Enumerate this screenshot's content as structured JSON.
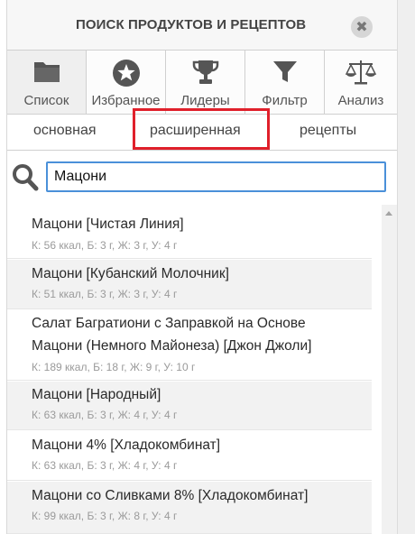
{
  "header": {
    "title": "ПОИСК ПРОДУКТОВ И РЕЦЕПТОВ",
    "close_symbol": "✖"
  },
  "toolbar": {
    "items": [
      {
        "label": "Список",
        "icon": "folder-icon",
        "active": true
      },
      {
        "label": "Избранное",
        "icon": "star-icon"
      },
      {
        "label": "Лидеры",
        "icon": "trophy-icon"
      },
      {
        "label": "Фильтр",
        "icon": "filter-icon"
      },
      {
        "label": "Анализ",
        "icon": "scales-icon"
      }
    ]
  },
  "subtabs": [
    "основная",
    "расширенная",
    "рецепты"
  ],
  "search": {
    "value": "Мацони",
    "icon": "search-icon"
  },
  "results": [
    {
      "name": "Мацони [Чистая Линия]",
      "nutrition": "К: 56 ккал, Б: 3 г, Ж: 3 г, У: 4 г"
    },
    {
      "name": "Мацони [Кубанский Молочник]",
      "nutrition": "К: 51 ккал, Б: 3 г, Ж: 3 г, У: 4 г"
    },
    {
      "name_line1": "Салат Багратиони с Заправкой на Основе",
      "name_line2": "Мацони (Немного Майонеза) [Джон Джоли]",
      "nutrition": "К: 189 ккал, Б: 18 г, Ж: 9 г, У: 10 г"
    },
    {
      "name": "Мацони [Народный]",
      "nutrition": "К: 63 ккал, Б: 3 г, Ж: 4 г, У: 4 г"
    },
    {
      "name": "Мацони 4% [Хладокомбинат]",
      "nutrition": "К: 63 ккал, Б: 3 г, Ж: 4 г, У: 4 г"
    },
    {
      "name": "Мацони со Сливками 8% [Хладокомбинат]",
      "nutrition": "К: 99 ккал, Б: 3 г, Ж: 8 г, У: 4 г"
    }
  ],
  "colors": {
    "highlight": "#e0202b",
    "input_border": "#4a90d9"
  }
}
